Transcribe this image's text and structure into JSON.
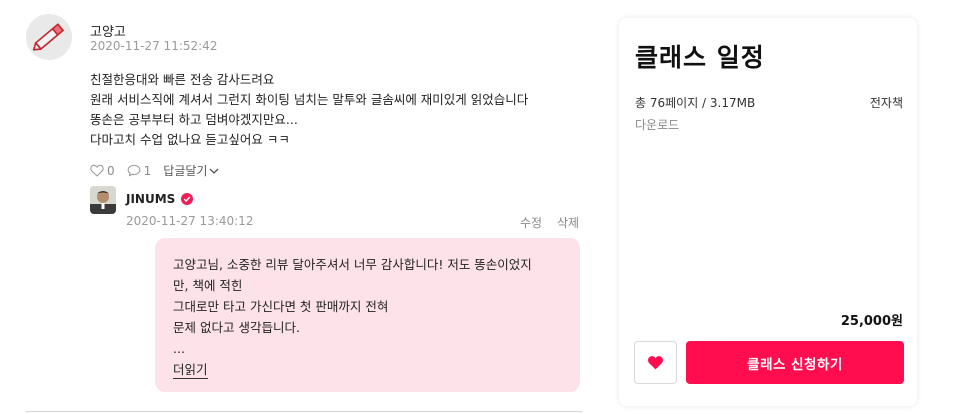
{
  "review": {
    "author": "고양고",
    "date": "2020-11-27 11:52:42",
    "lines": [
      "친절한응대와 빠른 전송 감사드려요",
      "원래 서비스직에 계셔서 그런지 화이팅 넘치는 말투와 글솜씨에 재미있게 읽었습니다",
      "똥손은 공부부터 하고 덤벼야겠지만요...",
      "다마고치 수업 없나요 듣고싶어요 ㅋㅋ"
    ],
    "like_count": "0",
    "comment_count": "1",
    "reply_toggle": "답글달기"
  },
  "reply": {
    "author": "JINUMS",
    "date": "2020-11-27 13:40:12",
    "edit_label": "수정",
    "delete_label": "삭제",
    "lines": [
      "고양고님, 소중한 리뷰 달아주셔서 너무 감사합니다! 저도 똥손이었지",
      "만, 책에 적힌",
      "그대로만 타고 가신다면 첫 판매까지 전혀",
      "문제 없다고 생각듭니다.",
      "..."
    ],
    "read_more": "더읽기"
  },
  "product": {
    "title": "클래스 일정",
    "meta": "총 76페이지 / 3.17MB",
    "type": "전자책",
    "download": "다운로드",
    "price": "25,000원",
    "apply_label": "클래스 신청하기"
  },
  "colors": {
    "accent": "#ff0d4f",
    "bubble": "#fde3e9",
    "verified": "#ee1f56"
  },
  "icons": [
    "pencil-avatar-icon",
    "heart-outline-icon",
    "comment-icon",
    "chevron-down-icon",
    "verified-badge-icon",
    "heart-filled-icon"
  ]
}
